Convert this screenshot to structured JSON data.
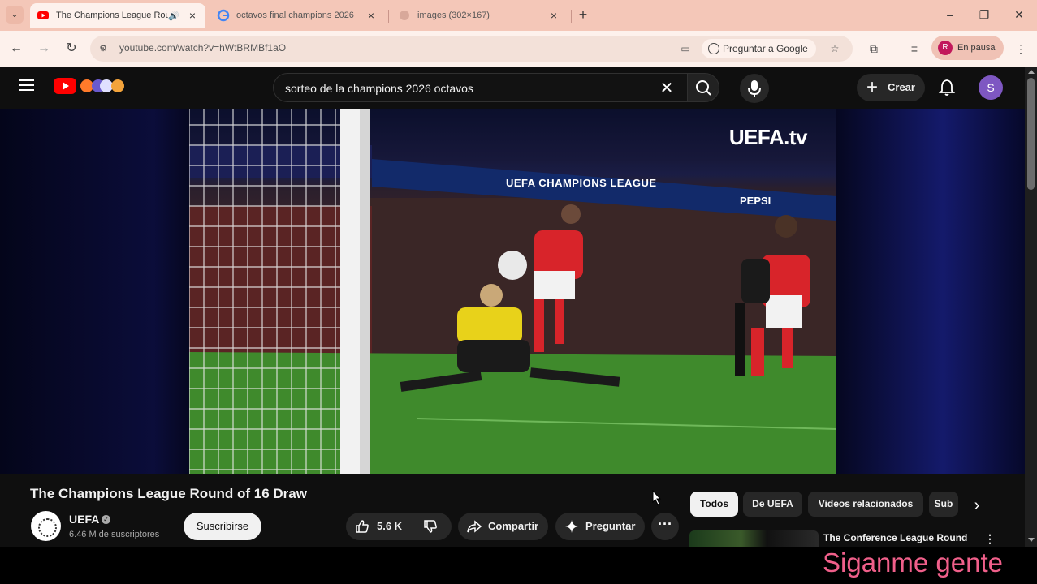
{
  "browser": {
    "tabs": [
      {
        "title": "The Champions League Rou",
        "favicon": "youtube-icon",
        "active": true,
        "audio": true
      },
      {
        "title": "octavos final champions 2026",
        "favicon": "google-icon",
        "active": false
      },
      {
        "title": "images (302×167)",
        "favicon": "globe-icon",
        "active": false
      }
    ],
    "url": "youtube.com/watch?v=hWtBRMBf1aO",
    "ask_google": "Preguntar a Google",
    "profile_initial": "R",
    "profile_status": "En pausa"
  },
  "youtube": {
    "search_query": "sorteo de la champions 2026 octavos",
    "create_label": "Crear",
    "user_initial": "S"
  },
  "video": {
    "overlay_brand": "UEFA.tv",
    "banner_text": "UEFA CHAMPIONS LEAGUE",
    "sponsor_text": "PEPSI",
    "title": "The Champions League Round of 16 Draw",
    "channel": "UEFA",
    "subscribers": "6.46 M de suscriptores",
    "subscribe_label": "Suscribirse",
    "likes": "5.6 K",
    "share_label": "Compartir",
    "ask_label": "Preguntar"
  },
  "chips": [
    "Todos",
    "De UEFA",
    "Videos relacionados",
    "Sub"
  ],
  "recommended": {
    "title": "The Conference League Round"
  },
  "overlay_caption": "Siganme gente"
}
